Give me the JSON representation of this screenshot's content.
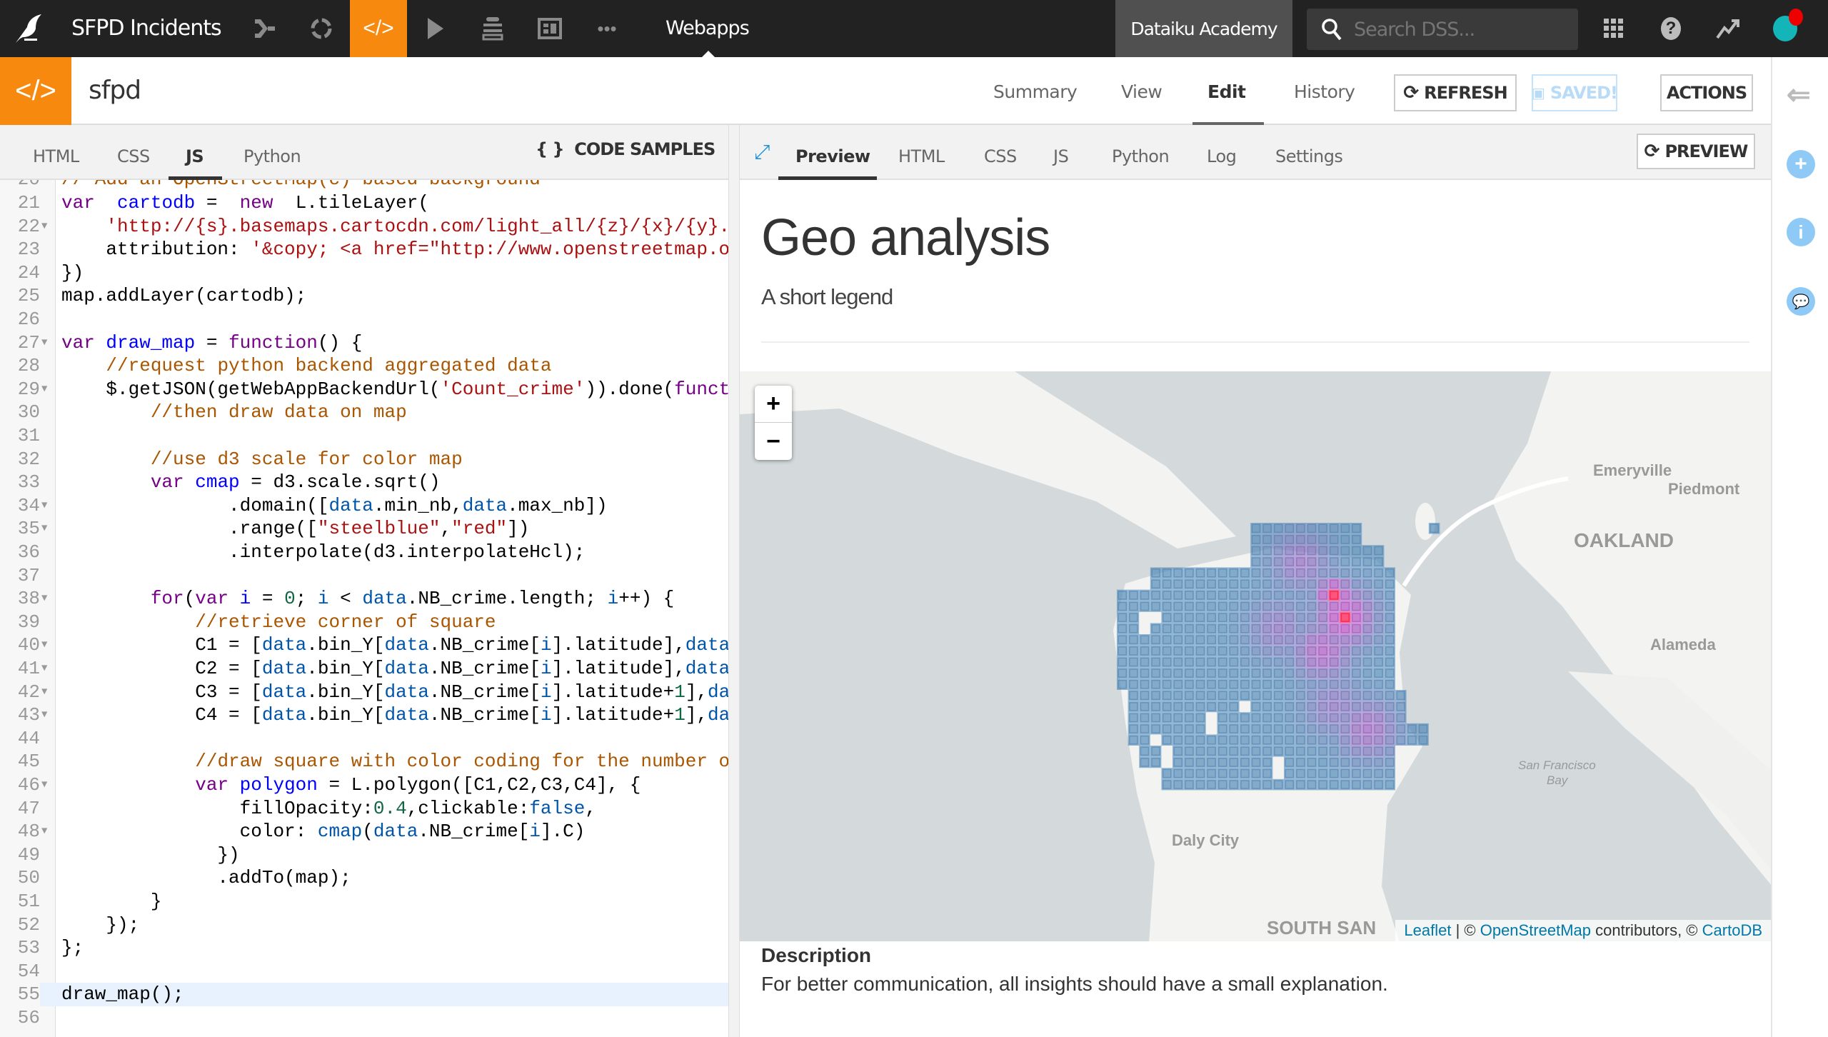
{
  "topbar": {
    "project": "SFPD Incidents",
    "section": "Webapps",
    "instance": "Dataiku Academy",
    "search_placeholder": "Search DSS...",
    "icons": [
      "bird-logo-icon",
      "flow-icon",
      "recipe-icon",
      "code-icon",
      "play-icon",
      "database-icon",
      "dashboard-icon",
      "more-icon",
      "apps-grid-icon",
      "help-icon",
      "activity-icon",
      "avatar"
    ],
    "accent": "#f7890f"
  },
  "subheader": {
    "name": "sfpd",
    "nav": [
      "Summary",
      "View",
      "Edit",
      "History"
    ],
    "active_nav": "Edit",
    "refresh": "REFRESH",
    "saved": "SAVED!",
    "actions": "ACTIONS"
  },
  "left_tabs": {
    "items": [
      "HTML",
      "CSS",
      "JS",
      "Python"
    ],
    "active": "JS",
    "code_samples": "CODE SAMPLES",
    "code_samples_icon": "{ }"
  },
  "right_tabs": {
    "items": [
      "Preview",
      "HTML",
      "CSS",
      "JS",
      "Python",
      "Log",
      "Settings"
    ],
    "active": "Preview",
    "preview_button": "PREVIEW"
  },
  "code": {
    "first_line": 20,
    "highlight_line": 55,
    "fold_lines": [
      22,
      27,
      29,
      34,
      35,
      38,
      40,
      41,
      42,
      43,
      46,
      48
    ],
    "lines": [
      [
        [
          "cm",
          "// Add an OpenStreetMap(c) based background"
        ]
      ],
      [
        [
          "kw",
          "var"
        ],
        [
          "",
          "  "
        ],
        [
          "def",
          "cartodb"
        ],
        [
          "",
          " =  "
        ],
        [
          "kw",
          "new"
        ],
        [
          "",
          "  L.tileLayer("
        ]
      ],
      [
        [
          "",
          "    "
        ],
        [
          "str",
          "'http://{s}.basemaps.cartocdn.com/light_all/{z}/{x}/{y}."
        ]
      ],
      [
        [
          "",
          "    attribution: "
        ],
        [
          "str",
          "'&copy; <a href=\"http://www.openstreetmap.o"
        ]
      ],
      [
        [
          "",
          "})"
        ]
      ],
      [
        [
          "",
          "map.addLayer(cartodb);"
        ]
      ],
      [],
      [
        [
          "kw",
          "var"
        ],
        [
          "",
          " "
        ],
        [
          "def",
          "draw_map"
        ],
        [
          "",
          " = "
        ],
        [
          "kw",
          "function"
        ],
        [
          "",
          "() {"
        ]
      ],
      [
        [
          "",
          "    "
        ],
        [
          "cm",
          "//request python backend aggregated data"
        ]
      ],
      [
        [
          "",
          "    $.getJSON(getWebAppBackendUrl("
        ],
        [
          "str",
          "'Count_crime'"
        ],
        [
          "",
          ")).done("
        ],
        [
          "kw",
          "funct"
        ]
      ],
      [
        [
          "",
          "        "
        ],
        [
          "cm",
          "//then draw data on map"
        ]
      ],
      [],
      [
        [
          "",
          "        "
        ],
        [
          "cm",
          "//use d3 scale for color map"
        ]
      ],
      [
        [
          "",
          "        "
        ],
        [
          "kw",
          "var"
        ],
        [
          "",
          " "
        ],
        [
          "def",
          "cmap"
        ],
        [
          "",
          " = d3.scale.sqrt()"
        ]
      ],
      [
        [
          "",
          "               .domain(["
        ],
        [
          "v2",
          "data"
        ],
        [
          "",
          ".min_nb,"
        ],
        [
          "v2",
          "data"
        ],
        [
          "",
          ".max_nb])"
        ]
      ],
      [
        [
          "",
          "               .range(["
        ],
        [
          "str",
          "\"steelblue\""
        ],
        [
          "",
          ","
        ],
        [
          "str",
          "\"red\""
        ],
        [
          "",
          "])"
        ]
      ],
      [
        [
          "",
          "               .interpolate(d3.interpolateHcl);"
        ]
      ],
      [],
      [
        [
          "",
          "        "
        ],
        [
          "kw",
          "for"
        ],
        [
          "",
          "("
        ],
        [
          "kw",
          "var"
        ],
        [
          "",
          " "
        ],
        [
          "def",
          "i"
        ],
        [
          "",
          " = "
        ],
        [
          "num",
          "0"
        ],
        [
          "",
          "; "
        ],
        [
          "v2",
          "i"
        ],
        [
          "",
          " < "
        ],
        [
          "v2",
          "data"
        ],
        [
          "",
          ".NB_crime.length; "
        ],
        [
          "v2",
          "i"
        ],
        [
          "",
          "++) {"
        ]
      ],
      [
        [
          "",
          "            "
        ],
        [
          "cm",
          "//retrieve corner of square"
        ]
      ],
      [
        [
          "",
          "            C1 = ["
        ],
        [
          "v2",
          "data"
        ],
        [
          "",
          ".bin_Y["
        ],
        [
          "v2",
          "data"
        ],
        [
          "",
          ".NB_crime["
        ],
        [
          "v2",
          "i"
        ],
        [
          "",
          "].latitude],"
        ],
        [
          "v2",
          "data"
        ]
      ],
      [
        [
          "",
          "            C2 = ["
        ],
        [
          "v2",
          "data"
        ],
        [
          "",
          ".bin_Y["
        ],
        [
          "v2",
          "data"
        ],
        [
          "",
          ".NB_crime["
        ],
        [
          "v2",
          "i"
        ],
        [
          "",
          "].latitude],"
        ],
        [
          "v2",
          "data"
        ]
      ],
      [
        [
          "",
          "            C3 = ["
        ],
        [
          "v2",
          "data"
        ],
        [
          "",
          ".bin_Y["
        ],
        [
          "v2",
          "data"
        ],
        [
          "",
          ".NB_crime["
        ],
        [
          "v2",
          "i"
        ],
        [
          "",
          "].latitude+"
        ],
        [
          "num",
          "1"
        ],
        [
          "",
          "],"
        ],
        [
          "v2",
          "da"
        ]
      ],
      [
        [
          "",
          "            C4 = ["
        ],
        [
          "v2",
          "data"
        ],
        [
          "",
          ".bin_Y["
        ],
        [
          "v2",
          "data"
        ],
        [
          "",
          ".NB_crime["
        ],
        [
          "v2",
          "i"
        ],
        [
          "",
          "].latitude+"
        ],
        [
          "num",
          "1"
        ],
        [
          "",
          "],"
        ],
        [
          "v2",
          "da"
        ]
      ],
      [],
      [
        [
          "",
          "            "
        ],
        [
          "cm",
          "//draw square with color coding for the number o"
        ]
      ],
      [
        [
          "",
          "            "
        ],
        [
          "kw",
          "var"
        ],
        [
          "",
          " "
        ],
        [
          "def",
          "polygon"
        ],
        [
          "",
          " = L.polygon([C1,C2,C3,C4], {"
        ]
      ],
      [
        [
          "",
          "                fillOpacity:"
        ],
        [
          "num",
          "0.4"
        ],
        [
          "",
          ",clickable:"
        ],
        [
          "v2",
          "false"
        ],
        [
          "",
          ","
        ]
      ],
      [
        [
          "",
          "                color: "
        ],
        [
          "v2",
          "cmap"
        ],
        [
          "",
          "("
        ],
        [
          "v2",
          "data"
        ],
        [
          "",
          ".NB_crime["
        ],
        [
          "v2",
          "i"
        ],
        [
          "",
          "].C)"
        ]
      ],
      [
        [
          "",
          "              })"
        ]
      ],
      [
        [
          "",
          "              .addTo(map);"
        ]
      ],
      [
        [
          "",
          "        }"
        ]
      ],
      [
        [
          "",
          "    });"
        ]
      ],
      [
        [
          "",
          "};"
        ]
      ],
      [],
      [
        [
          "",
          "draw_map();"
        ]
      ],
      []
    ]
  },
  "preview": {
    "title": "Geo analysis",
    "legend": "A short legend",
    "map": {
      "zoom_in": "+",
      "zoom_out": "−",
      "labels": {
        "emeryville": "Emeryville",
        "piedmont": "Piedmont",
        "oakland": "OAKLAND",
        "alameda": "Alameda",
        "bay1": "San Francisco",
        "bay2": "Bay",
        "daly": "Daly City",
        "south": "SOUTH SAN"
      },
      "attribution": {
        "leaflet": "Leaflet",
        "sep": " | © ",
        "osm": "OpenStreetMap",
        "mid": " contributors, © ",
        "carto": "CartoDB"
      },
      "color_low": "steelblue",
      "color_high": "red",
      "fill_opacity": 0.4
    },
    "description_heading": "Description",
    "description": "For better communication, all insights should have a small explanation."
  }
}
